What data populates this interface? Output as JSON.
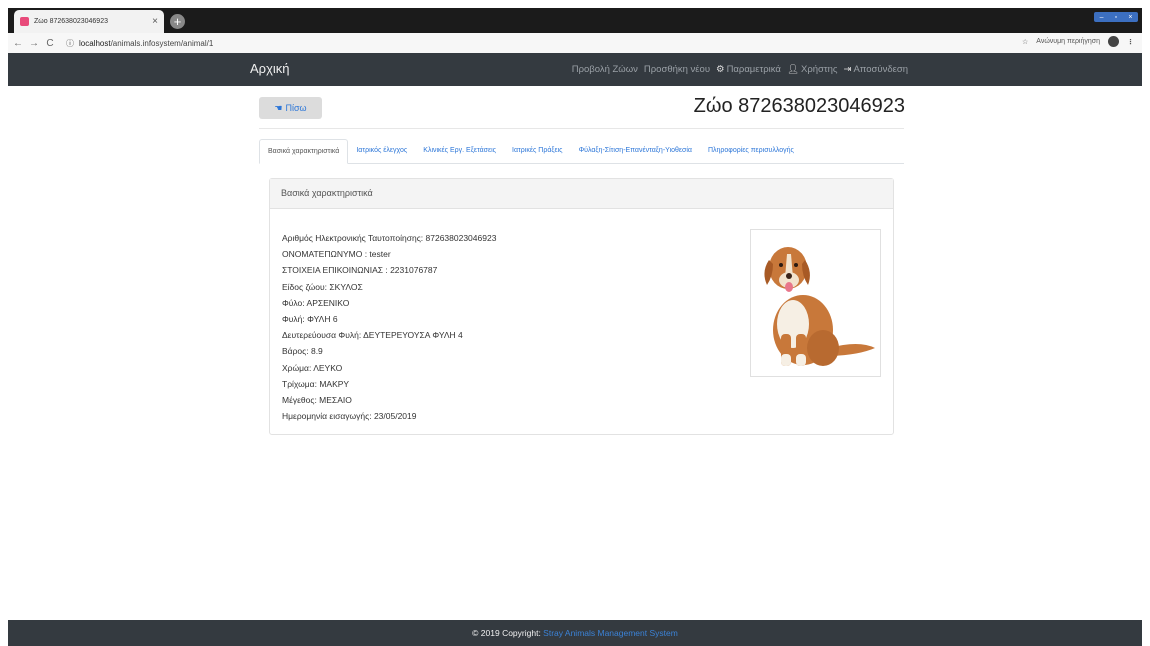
{
  "browser": {
    "tab_title": "Ζώο 872638023046923",
    "tab_close": "×",
    "new_tab": "+",
    "window_controls": [
      "–",
      "▫",
      "×"
    ],
    "url_domain": "localhost",
    "url_path": "/animals.infosystem/animal/1",
    "paused_label": "Ανώνυμη περιήγηση",
    "icons": [
      "back-icon",
      "forward-icon",
      "reload-icon",
      "info-icon",
      "star-icon",
      "avatar-icon",
      "menu-icon"
    ]
  },
  "navbar": {
    "brand": "Αρχική",
    "links": [
      {
        "label": "Προβολή Ζώων"
      },
      {
        "label": "Προσθήκη νέου"
      },
      {
        "label": "Παραμετρικά",
        "icon": "cogs-icon"
      },
      {
        "label": "Χρήστης",
        "icon": "user-icon"
      },
      {
        "label": "Αποσύνδεση",
        "icon": "sign-out-icon"
      }
    ]
  },
  "page": {
    "back_label": "Πίσω",
    "title": "Ζώο 872638023046923"
  },
  "tabs": [
    {
      "label": "Βασικά χαρακτηριστικά",
      "active": true
    },
    {
      "label": "Ιατρικός έλεγχος"
    },
    {
      "label": "Κλινικές Εργ. Εξετάσεις"
    },
    {
      "label": "Ιατρικές Πράξεις"
    },
    {
      "label": "Φύλαξη-Σίτιση-Επανένταξη-Υιοθεσία"
    },
    {
      "label": "Πληροφορίες περισυλλογής"
    }
  ],
  "card": {
    "header": "Βασικά χαρακτηριστικά",
    "fields": [
      "Αριθμός Ηλεκτρονικής Ταυτοποίησης: 872638023046923",
      "ΟΝΟΜΑΤΕΠΩΝΥΜΟ : tester",
      "ΣΤΟΙΧΕΙΑ ΕΠΙΚΟΙΝΩΝΙΑΣ : 2231076787",
      "Είδος ζώου: ΣΚΥΛΟΣ",
      "Φύλο: ΑΡΣΕΝΙΚΟ",
      "Φυλή: ΦΥΛΗ 6",
      "Δευτερεύουσα Φυλή: ΔΕΥΤΕΡΕΥΟΥΣΑ ΦΥΛΗ 4",
      "Βάρος: 8.9",
      "Χρώμα: ΛΕΥΚΟ",
      "Τρίχωμα: ΜΑΚΡΥ",
      "Μέγεθος: ΜΕΣΑΙΟ",
      "Ημερομηνία εισαγωγής: 23/05/2019"
    ]
  },
  "footer": {
    "prefix": "© 2019 Copyright: ",
    "system": "Stray Animals Management System"
  },
  "colors": {
    "navbar_bg": "#343a40",
    "link": "#2c76d8",
    "dog_fur": "#c8783a",
    "dog_chest": "#f6efe4"
  }
}
